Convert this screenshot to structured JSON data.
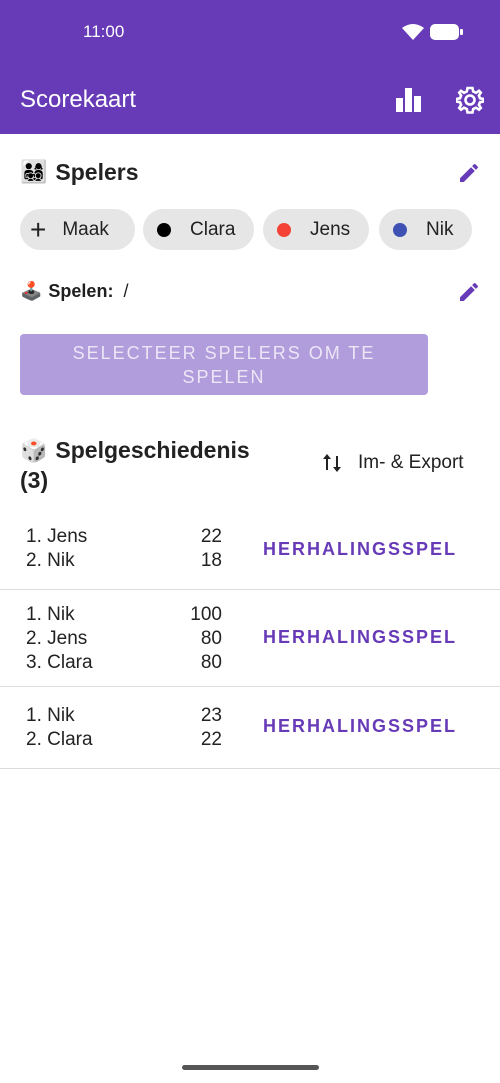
{
  "status_bar": {
    "time": "11:00"
  },
  "app_bar": {
    "title": "Scorekaart"
  },
  "players_section": {
    "emoji": "👨‍👩‍👧‍👦",
    "title": "Spelers",
    "chips": [
      {
        "label": "Maak",
        "kind": "add"
      },
      {
        "label": "Clara",
        "color": "#000000"
      },
      {
        "label": "Jens",
        "color": "#f44336"
      },
      {
        "label": "Nik",
        "color": "#3f51b5"
      }
    ]
  },
  "play_section": {
    "emoji": "🕹️",
    "label": "Spelen:",
    "value": "/"
  },
  "select_button": {
    "label": "SELECTEER SPELERS OM TE SPELEN"
  },
  "history": {
    "emoji": "🎲",
    "title": "Spelgeschiedenis (3)",
    "import_export_label": "Im- & Export",
    "games": [
      {
        "players": [
          {
            "rank": "1. Jens",
            "score": "22"
          },
          {
            "rank": "2. Nik",
            "score": "18"
          }
        ],
        "replay_label": "HERHALINGSSPEL"
      },
      {
        "players": [
          {
            "rank": "1. Nik",
            "score": "100"
          },
          {
            "rank": "2. Jens",
            "score": "80"
          },
          {
            "rank": "3. Clara",
            "score": "80"
          }
        ],
        "replay_label": "HERHALINGSSPEL"
      },
      {
        "players": [
          {
            "rank": "1. Nik",
            "score": "23"
          },
          {
            "rank": "2. Clara",
            "score": "22"
          }
        ],
        "replay_label": "HERHALINGSSPEL"
      }
    ]
  },
  "colors": {
    "primary": "#673ab7",
    "primary_light": "#b19ddb"
  }
}
